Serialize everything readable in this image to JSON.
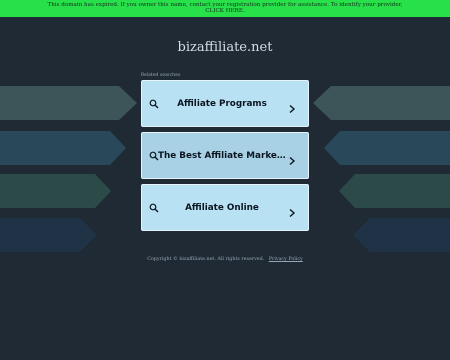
{
  "banner": {
    "line1": "This domain has expired. If you owner this name, contact your registration provider for assistance. To identify your provider,",
    "line2": "CLICK HERE."
  },
  "domain": "bizaffiliate.net",
  "related_label": "Related searches",
  "cards": [
    {
      "label": "Affiliate Programs",
      "bg": "#b8e1f4"
    },
    {
      "label": "The Best Affiliate Marketing Programs",
      "bg": "#a8d1e5"
    },
    {
      "label": "Affiliate Online",
      "bg": "#b8e1f4"
    }
  ],
  "footer": {
    "copyright": "Copyright © bizaffiliate.net.  All rights reserved.",
    "privacy": "Privacy Policy"
  },
  "colors": {
    "background": "#1f2a35",
    "banner": "#27e04a",
    "card_border": "#e8f4fb"
  },
  "icons": {
    "search": "search-icon",
    "chevron": "chevron-right-icon"
  }
}
